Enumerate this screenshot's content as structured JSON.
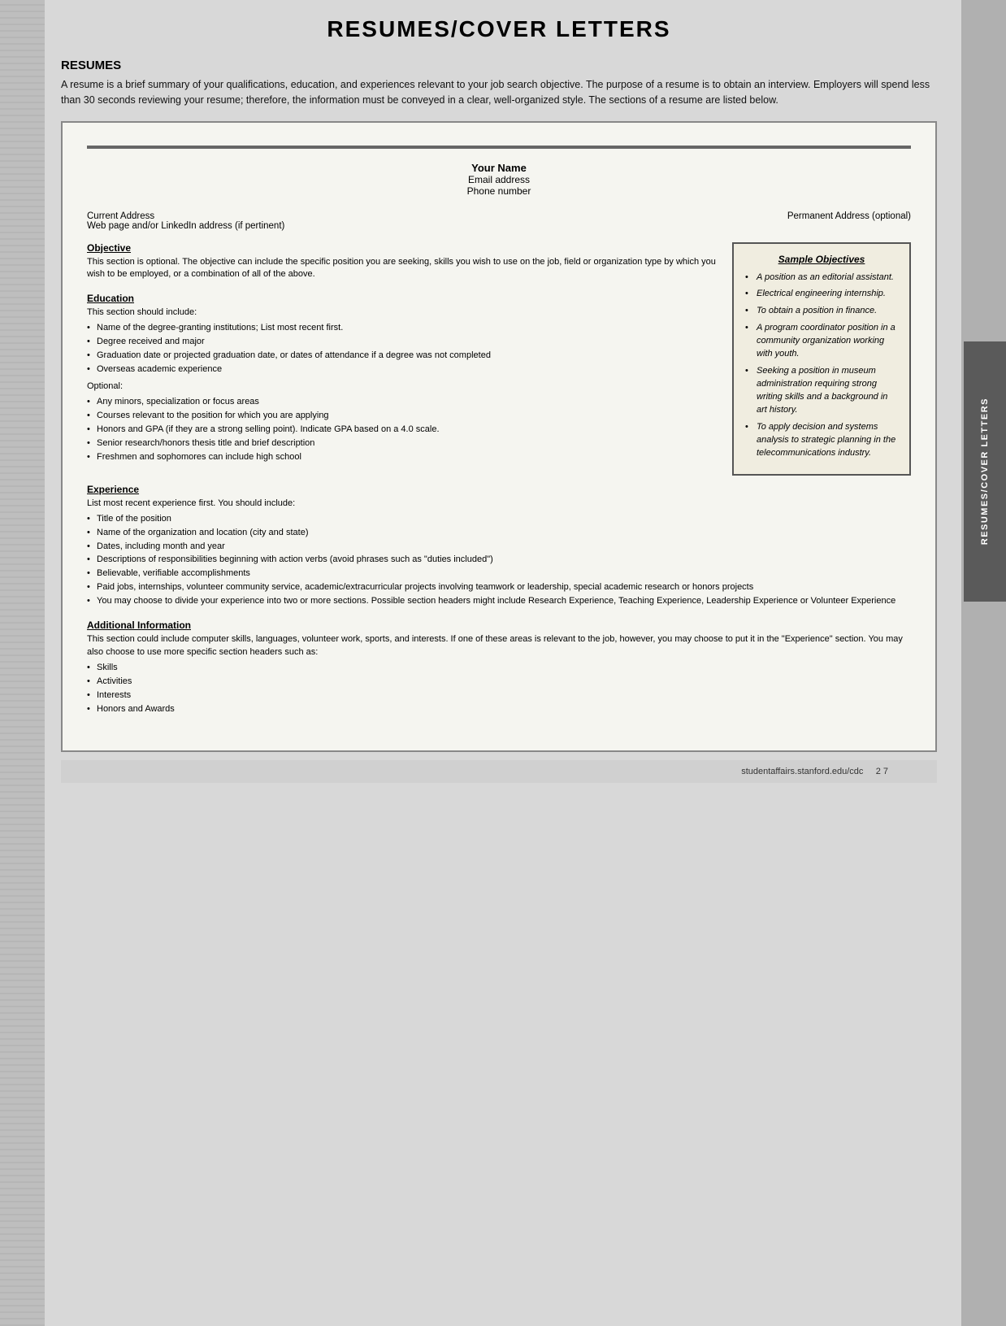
{
  "page": {
    "title": "RESUMES/COVER LETTERS",
    "footer_url": "studentaffairs.stanford.edu/cdc",
    "footer_page": "2  7"
  },
  "right_tab": {
    "label": "RESUMES/COVER LETTERS"
  },
  "resumes_section": {
    "heading": "RESUMES",
    "intro": "A resume is a brief summary of your qualifications, education, and experiences relevant to your job search objective. The purpose of a resume is to obtain an interview. Employers will spend less than 30 seconds reviewing your resume; therefore, the information must be conveyed in a clear, well-organized style. The sections of a resume are listed below."
  },
  "resume_doc": {
    "your_name": "Your Name",
    "email": "Email address",
    "phone": "Phone number",
    "current_address": "Current Address",
    "web_address": "Web page and/or LinkedIn address (if pertinent)",
    "permanent_address": "Permanent Address (optional)"
  },
  "objective_section": {
    "title": "Objective",
    "text": "This section is optional. The objective can include the specific position you are seeking, skills you wish to use on the job, field or organization type by which you wish to be employed, or a combination of all of the above."
  },
  "sample_objectives": {
    "title": "Sample Objectives",
    "items": [
      "A position as an editorial assistant.",
      "Electrical engineering internship.",
      "To obtain a position in finance.",
      "A program coordinator position in a community organization working with youth.",
      "Seeking a position in museum administration requiring strong writing skills and a background in art history.",
      "To apply decision and systems analysis to strategic planning in the telecommunications industry."
    ]
  },
  "education_section": {
    "title": "Education",
    "intro": "This section should include:",
    "items": [
      "Name of the degree-granting institutions; List most recent first.",
      "Degree received and major",
      "Graduation date or projected graduation date, or dates of attendance if a degree was not completed",
      "Overseas academic experience"
    ],
    "optional_label": "Optional:",
    "optional_items": [
      "Any minors, specialization or focus areas",
      "Courses relevant to the position for which you are applying",
      "Honors and GPA (if they are a strong selling point). Indicate GPA based on a 4.0 scale.",
      "Senior research/honors thesis title and brief description",
      "Freshmen and sophomores can include high school"
    ]
  },
  "experience_section": {
    "title": "Experience",
    "intro": "List most recent experience first. You should include:",
    "items": [
      "Title of the position",
      "Name of the organization and location (city and state)",
      "Dates, including month and year",
      "Descriptions of responsibilities beginning with action verbs (avoid phrases such as \"duties included\")",
      "Believable, verifiable accomplishments",
      "Paid jobs, internships, volunteer community service, academic/extracurricular projects involving teamwork or leadership, special academic research or honors projects",
      "You may choose to divide your experience into two or more sections. Possible section headers might include Research Experience, Teaching Experience, Leadership Experience or Volunteer Experience"
    ]
  },
  "additional_info_section": {
    "title": "Additional Information",
    "text": "This section could include computer skills, languages, volunteer work, sports, and interests. If one of these areas is relevant to the job, however, you may choose to put it in the \"Experience\" section. You may also choose to use more specific section headers such as:",
    "items": [
      "Skills",
      "Activities",
      "Interests",
      "Honors and Awards"
    ]
  }
}
